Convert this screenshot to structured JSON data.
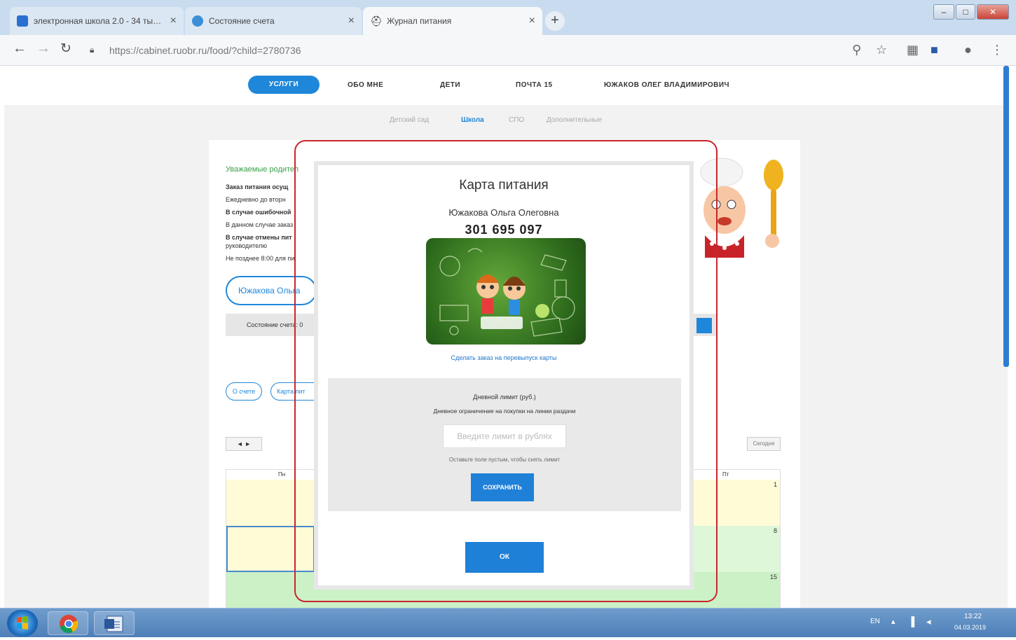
{
  "browser": {
    "tabs": [
      {
        "label": "электронная школа 2.0 - 34 ты…",
        "color": "#2b6fd1"
      },
      {
        "label": "Состояние счета",
        "color": "#3a8fd8"
      },
      {
        "label": "Журнал питания",
        "color": "#333333"
      }
    ],
    "new_tab": "+",
    "url": "https://cabinet.ruobr.ru/food/?child=2780736",
    "window_buttons": [
      "–",
      "□",
      "✕"
    ]
  },
  "site": {
    "nav": {
      "services": "УСЛУГИ",
      "about": "ОБО МНЕ",
      "children": "ДЕТИ",
      "mail": "ПОЧТА 15",
      "user": "ЮЖАКОВ ОЛЕГ ВЛАДИМИРОВИЧ"
    },
    "subnav": [
      "Детский сад",
      "Школа",
      "СПО",
      "Дополнительные"
    ],
    "accent": "#1f87d9"
  },
  "background": {
    "greeting": "Уважаемые родител",
    "lines": [
      "Заказ питания осущ",
      "Ежедневно до вторн",
      "В случае ошибочной",
      "В данном случае заказ",
      "В случае отмены пит",
      "руководителю",
      "Не позднее 8:00 для пи"
    ],
    "child_button": "Южакова Ольга",
    "account_state": "Состояние счета: 0",
    "chip_account": "О счете",
    "chip_card": "Карта пит",
    "calendar": {
      "nav": "◄ ►",
      "today": "Сегодня",
      "col_mon": "Пн",
      "col_fri": "Пт",
      "dates": [
        "1",
        "8",
        "15"
      ]
    }
  },
  "modal": {
    "title": "Карта питания",
    "student_name": "Южакова Ольга Олеговна",
    "card_number": "301 695 097",
    "order_link": "Сделать заказ на перевыпуск карты",
    "limit": {
      "title": "Дневной лимит (руб.)",
      "description": "Дневное ограничение на покупки на линии раздачи",
      "input_placeholder": "Введите лимит в рублях",
      "hint": "Оставьте поле пустым, чтобы снять лимит",
      "save_label": "СОХРАНИТЬ"
    },
    "ok_label": "ОК"
  },
  "taskbar": {
    "lang": "EN",
    "time": "13:22",
    "date": "04.03.2019"
  }
}
